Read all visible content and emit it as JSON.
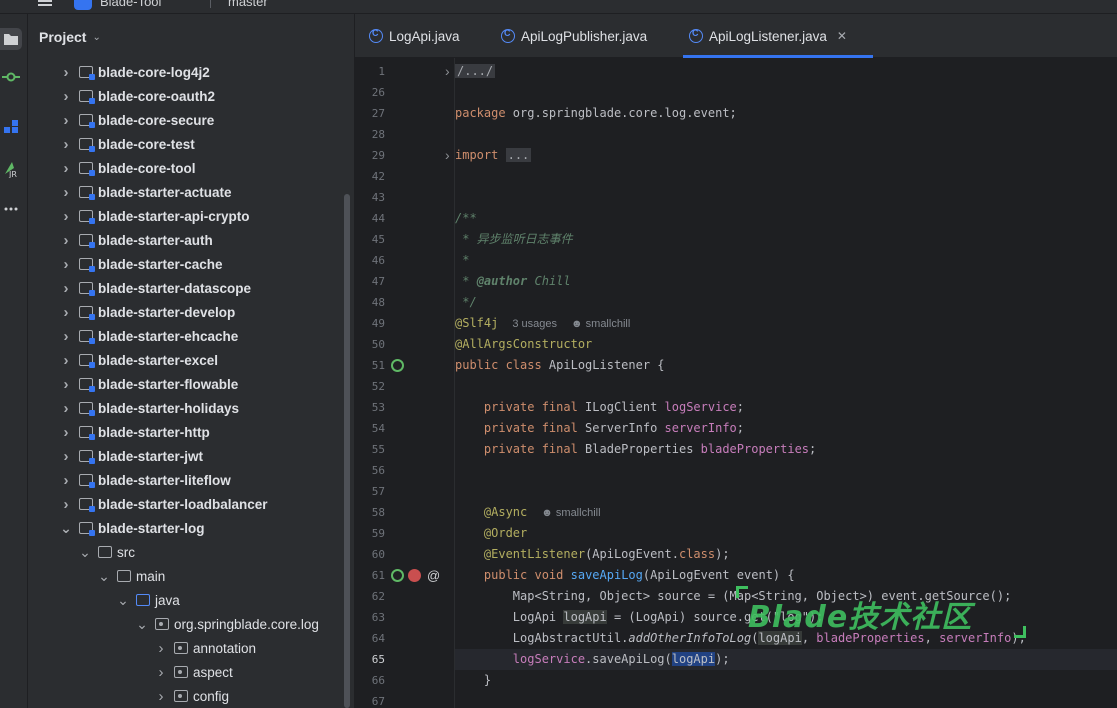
{
  "titlebar": {
    "app_name": "Blade-Tool",
    "branch": "master"
  },
  "project_panel": {
    "title": "Project",
    "tree": [
      {
        "label": "blade-core-log4j2",
        "kind": "module",
        "depth": 0,
        "expanded": false,
        "bold": true
      },
      {
        "label": "blade-core-oauth2",
        "kind": "module",
        "depth": 0,
        "expanded": false,
        "bold": true
      },
      {
        "label": "blade-core-secure",
        "kind": "module",
        "depth": 0,
        "expanded": false,
        "bold": true
      },
      {
        "label": "blade-core-test",
        "kind": "module",
        "depth": 0,
        "expanded": false,
        "bold": true
      },
      {
        "label": "blade-core-tool",
        "kind": "module",
        "depth": 0,
        "expanded": false,
        "bold": true
      },
      {
        "label": "blade-starter-actuate",
        "kind": "module",
        "depth": 0,
        "expanded": false,
        "bold": true
      },
      {
        "label": "blade-starter-api-crypto",
        "kind": "module",
        "depth": 0,
        "expanded": false,
        "bold": true
      },
      {
        "label": "blade-starter-auth",
        "kind": "module",
        "depth": 0,
        "expanded": false,
        "bold": true
      },
      {
        "label": "blade-starter-cache",
        "kind": "module",
        "depth": 0,
        "expanded": false,
        "bold": true
      },
      {
        "label": "blade-starter-datascope",
        "kind": "module",
        "depth": 0,
        "expanded": false,
        "bold": true
      },
      {
        "label": "blade-starter-develop",
        "kind": "module",
        "depth": 0,
        "expanded": false,
        "bold": true
      },
      {
        "label": "blade-starter-ehcache",
        "kind": "module",
        "depth": 0,
        "expanded": false,
        "bold": true
      },
      {
        "label": "blade-starter-excel",
        "kind": "module",
        "depth": 0,
        "expanded": false,
        "bold": true
      },
      {
        "label": "blade-starter-flowable",
        "kind": "module",
        "depth": 0,
        "expanded": false,
        "bold": true
      },
      {
        "label": "blade-starter-holidays",
        "kind": "module",
        "depth": 0,
        "expanded": false,
        "bold": true
      },
      {
        "label": "blade-starter-http",
        "kind": "module",
        "depth": 0,
        "expanded": false,
        "bold": true
      },
      {
        "label": "blade-starter-jwt",
        "kind": "module",
        "depth": 0,
        "expanded": false,
        "bold": true
      },
      {
        "label": "blade-starter-liteflow",
        "kind": "module",
        "depth": 0,
        "expanded": false,
        "bold": true
      },
      {
        "label": "blade-starter-loadbalancer",
        "kind": "module",
        "depth": 0,
        "expanded": false,
        "bold": true
      },
      {
        "label": "blade-starter-log",
        "kind": "module",
        "depth": 0,
        "expanded": true,
        "bold": true
      },
      {
        "label": "src",
        "kind": "folder",
        "depth": 1,
        "expanded": true,
        "bold": false
      },
      {
        "label": "main",
        "kind": "folder",
        "depth": 2,
        "expanded": true,
        "bold": false
      },
      {
        "label": "java",
        "kind": "folder-blue",
        "depth": 3,
        "expanded": true,
        "bold": false
      },
      {
        "label": "org.springblade.core.log",
        "kind": "package",
        "depth": 4,
        "expanded": true,
        "bold": false
      },
      {
        "label": "annotation",
        "kind": "package",
        "depth": 5,
        "expanded": false,
        "bold": false
      },
      {
        "label": "aspect",
        "kind": "package",
        "depth": 5,
        "expanded": false,
        "bold": false
      },
      {
        "label": "config",
        "kind": "package",
        "depth": 5,
        "expanded": false,
        "bold": false
      }
    ]
  },
  "tabs": [
    {
      "label": "LogApi.java",
      "active": false
    },
    {
      "label": "ApiLogPublisher.java",
      "active": false
    },
    {
      "label": "ApiLogListener.java",
      "active": true
    }
  ],
  "editor": {
    "line_numbers": [
      "1",
      "26",
      "27",
      "28",
      "29",
      "42",
      "43",
      "44",
      "45",
      "46",
      "47",
      "48",
      "49",
      "50",
      "51",
      "52",
      "53",
      "54",
      "55",
      "56",
      "57",
      "58",
      "59",
      "60",
      "61",
      "62",
      "63",
      "64",
      "65",
      "66",
      "67"
    ],
    "current_line": "65",
    "code": {
      "l1": "/.../",
      "l27_kw": "package",
      "l27_rest": " org.springblade.core.log.event;",
      "l29_kw": "import",
      "l29_fold": "...",
      "l44": "/**",
      "l45": " * 异步监听日志事件",
      "l46": " *",
      "l47_a": " * ",
      "l47_tag": "@author",
      "l47_b": " Chill",
      "l48": " */",
      "l49_ann": "@Slf4j",
      "l49_usages": "3 usages",
      "l49_author": "smallchill",
      "l50_ann": "@AllArgsConstructor",
      "l51_kw": "public class",
      "l51_rest": " ApiLogListener {",
      "l53_kw": "private final",
      "l53_type": " ILogClient ",
      "l53_field": "logService",
      "l53_end": ";",
      "l54_kw": "private final",
      "l54_type": " ServerInfo ",
      "l54_field": "serverInfo",
      "l54_end": ";",
      "l55_kw": "private final",
      "l55_type": " BladeProperties ",
      "l55_field": "bladeProperties",
      "l55_end": ";",
      "l58_ann": "@Async",
      "l58_author": "smallchill",
      "l59_ann": "@Order",
      "l60_ann": "@EventListener",
      "l60_rest": "(ApiLogEvent.",
      "l60_kw": "class",
      "l60_end": ");",
      "l61_kw": "public void",
      "l61_fn": " saveApiLog",
      "l61_rest": "(ApiLogEvent event) {",
      "l62": "Map<String, Object> source = (Map<String, Object>) event.getSource();",
      "l63_a": "LogApi ",
      "l63_var": "logApi",
      "l63_b": " = (LogApi) source.get(\"log\");",
      "l64_a": "LogAbstractUtil.",
      "l64_fn": "addOtherInfoToLog",
      "l64_b": "(",
      "l64_arg1": "logApi",
      "l64_c": ", ",
      "l64_f1": "bladeProperties",
      "l64_d": ", ",
      "l64_f2": "serverInfo",
      "l64_e": ");",
      "l65_field": "logService",
      "l65_b": ".saveApiLog(",
      "l65_sel": "logApi",
      "l65_end": ");",
      "l66": "}"
    }
  },
  "watermark": {
    "text": "Blade技术社区"
  },
  "colors": {
    "accent": "#3574f0",
    "keyword": "#cf8e6d",
    "annotation": "#b3ae60",
    "field": "#c77dbb",
    "function": "#56a8f5",
    "doc": "#5f826b"
  }
}
